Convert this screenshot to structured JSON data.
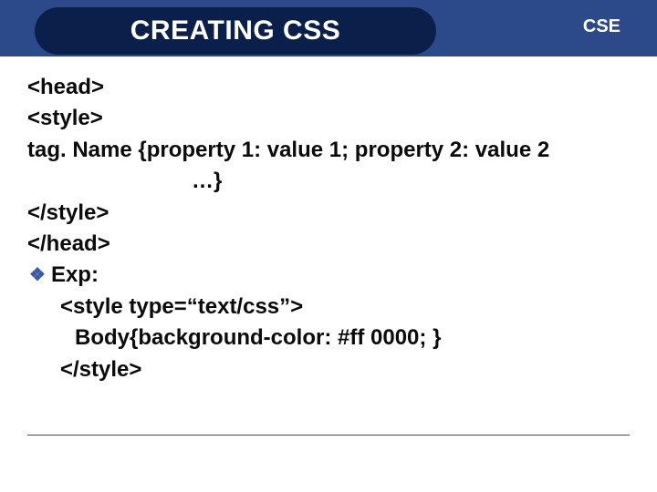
{
  "header": {
    "title": "CREATING CSS",
    "badge": "CSE"
  },
  "body": {
    "l1": "<head>",
    "l2": "<style>",
    "l3": "tag. Name {property 1: value 1; property 2: value 2",
    "l4": "…}",
    "l5": "</style>",
    "l6": "</head>",
    "bullet": "❖",
    "exp_label": "Exp:",
    "exp1": "<style type=“text/css”>",
    "exp2": "Body{background-color: #ff 0000; }",
    "exp3": "</style>"
  }
}
